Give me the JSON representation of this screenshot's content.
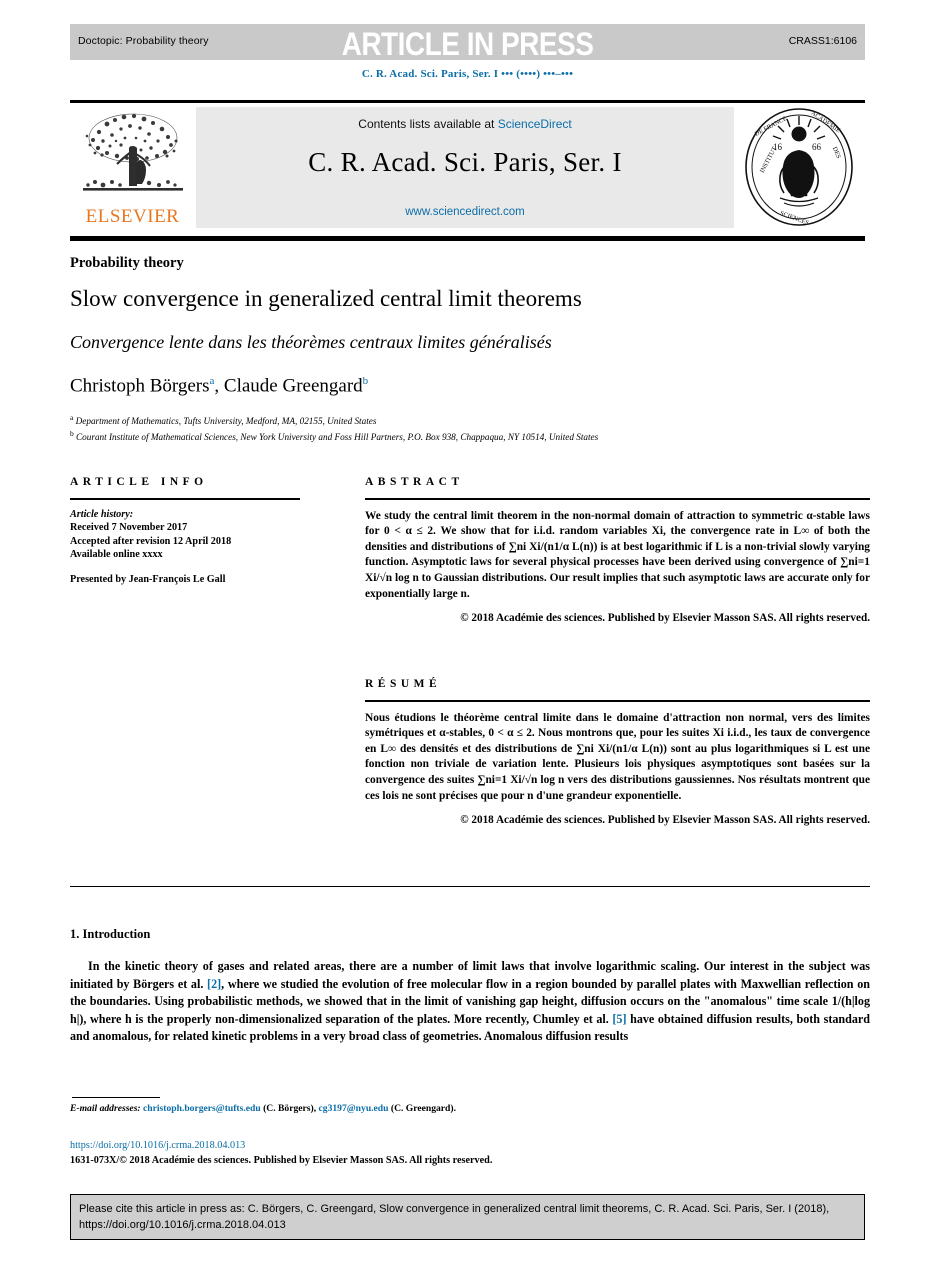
{
  "header": {
    "doctopic": "Doctopic: Probability theory",
    "press_banner": "ARTICLE IN PRESS",
    "article_id": "CRASS1:6106",
    "running_citation": "C. R. Acad. Sci. Paris, Ser. I ••• (••••) •••–•••"
  },
  "masthead": {
    "contents_prefix": "Contents lists available at ",
    "sciencedirect_link": "ScienceDirect",
    "journal_title": "C. R. Acad. Sci. Paris, Ser. I",
    "journal_url": "www.sciencedirect.com",
    "publisher_wordmark": "ELSEVIER",
    "seal_text_top": "INSTITUT DE FRANCE",
    "seal_text_right": "ACADÉMIE DES SCIENCES",
    "seal_year": "1666"
  },
  "title_block": {
    "section_label": "Probability theory",
    "title": "Slow convergence in generalized central limit theorems",
    "subtitle": "Convergence lente dans les théorèmes centraux limites généralisés",
    "authors": [
      {
        "name": "Christoph Börgers",
        "marker": "a"
      },
      {
        "name": "Claude Greengard",
        "marker": "b"
      }
    ],
    "authors_separator": ", ",
    "affiliations": [
      {
        "marker": "a",
        "text": "Department of Mathematics, Tufts University, Medford, MA, 02155, United States"
      },
      {
        "marker": "b",
        "text": "Courant Institute of Mathematical Sciences, New York University and Foss Hill Partners, P.O. Box 938, Chappaqua, NY 10514, United States"
      }
    ]
  },
  "article_info": {
    "heading": "ARTICLE INFO",
    "history_label": "Article history:",
    "history": [
      "Received 7 November 2017",
      "Accepted after revision 12 April 2018",
      "Available online xxxx"
    ],
    "presented_by": "Presented by Jean-François Le Gall"
  },
  "abstract": {
    "heading": "ABSTRACT",
    "text": "We study the central limit theorem in the non-normal domain of attraction to symmetric α-stable laws for 0 < α ≤ 2. We show that for i.i.d. random variables Xi, the convergence rate in L∞ of both the densities and distributions of ∑ni Xi/(n1/α L(n)) is at best logarithmic if L is a non-trivial slowly varying function. Asymptotic laws for several physical processes have been derived using convergence of ∑ni=1 Xi/√n log n to Gaussian distributions. Our result implies that such asymptotic laws are accurate only for exponentially large n.",
    "copyright": "© 2018 Académie des sciences. Published by Elsevier Masson SAS. All rights reserved."
  },
  "resume": {
    "heading": "RÉSUMÉ",
    "text": "Nous étudions le théorème central limite dans le domaine d'attraction non normal, vers des limites symétriques et α-stables, 0 < α ≤ 2. Nous montrons que, pour les suites Xi i.i.d., les taux de convergence en L∞ des densités et des distributions de ∑ni Xi/(n1/α L(n)) sont au plus logarithmiques si L est une fonction non triviale de variation lente. Plusieurs lois physiques asymptotiques sont basées sur la convergence des suites ∑ni=1 Xi/√n log n vers des distributions gaussiennes. Nos résultats montrent que ces lois ne sont précises que pour n d'une grandeur exponentielle.",
    "copyright": "© 2018 Académie des sciences. Published by Elsevier Masson SAS. All rights reserved."
  },
  "body": {
    "section_number_title": "1. Introduction",
    "paragraph_1_part1": "In the kinetic theory of gases and related areas, there are a number of limit laws that involve logarithmic scaling. Our interest in the subject was initiated by Börgers et al. ",
    "ref_2": "[2]",
    "paragraph_1_part2": ", where we studied the evolution of free molecular flow in a region bounded by parallel plates with Maxwellian reflection on the boundaries. Using probabilistic methods, we showed that in the limit of vanishing gap height, diffusion occurs on the \"anomalous\" time scale 1/(h|log h|), where h is the properly non-dimensionalized separation of the plates. More recently, Chumley et al. ",
    "ref_5": "[5]",
    "paragraph_1_part3": " have obtained diffusion results, both standard and anomalous, for related kinetic problems in a very broad class of geometries. Anomalous diffusion results"
  },
  "footnote": {
    "email_label": "E-mail addresses:",
    "email_1": "christoph.borgers@tufts.edu",
    "email_1_owner": "(C. Börgers)",
    "email_2": "cg3197@nyu.edu",
    "email_2_owner": "(C. Greengard).",
    "separator": ", ",
    "doi": "https://doi.org/10.1016/j.crma.2018.04.013",
    "issn_line": "1631-073X/© 2018 Académie des sciences. Published by Elsevier Masson SAS. All rights reserved."
  },
  "cite_box": {
    "text": "Please cite this article in press as: C. Börgers, C. Greengard, Slow convergence in generalized central limit theorems, C. R. Acad. Sci. Paris, Ser. I (2018), https://doi.org/10.1016/j.crma.2018.04.013"
  },
  "colors": {
    "link": "#0b6ea8",
    "elsevier_orange": "#e87722",
    "press_bar": "#c9c9c9",
    "masthead_band": "#e9e9e9",
    "cite_box": "#cfcfcf"
  }
}
